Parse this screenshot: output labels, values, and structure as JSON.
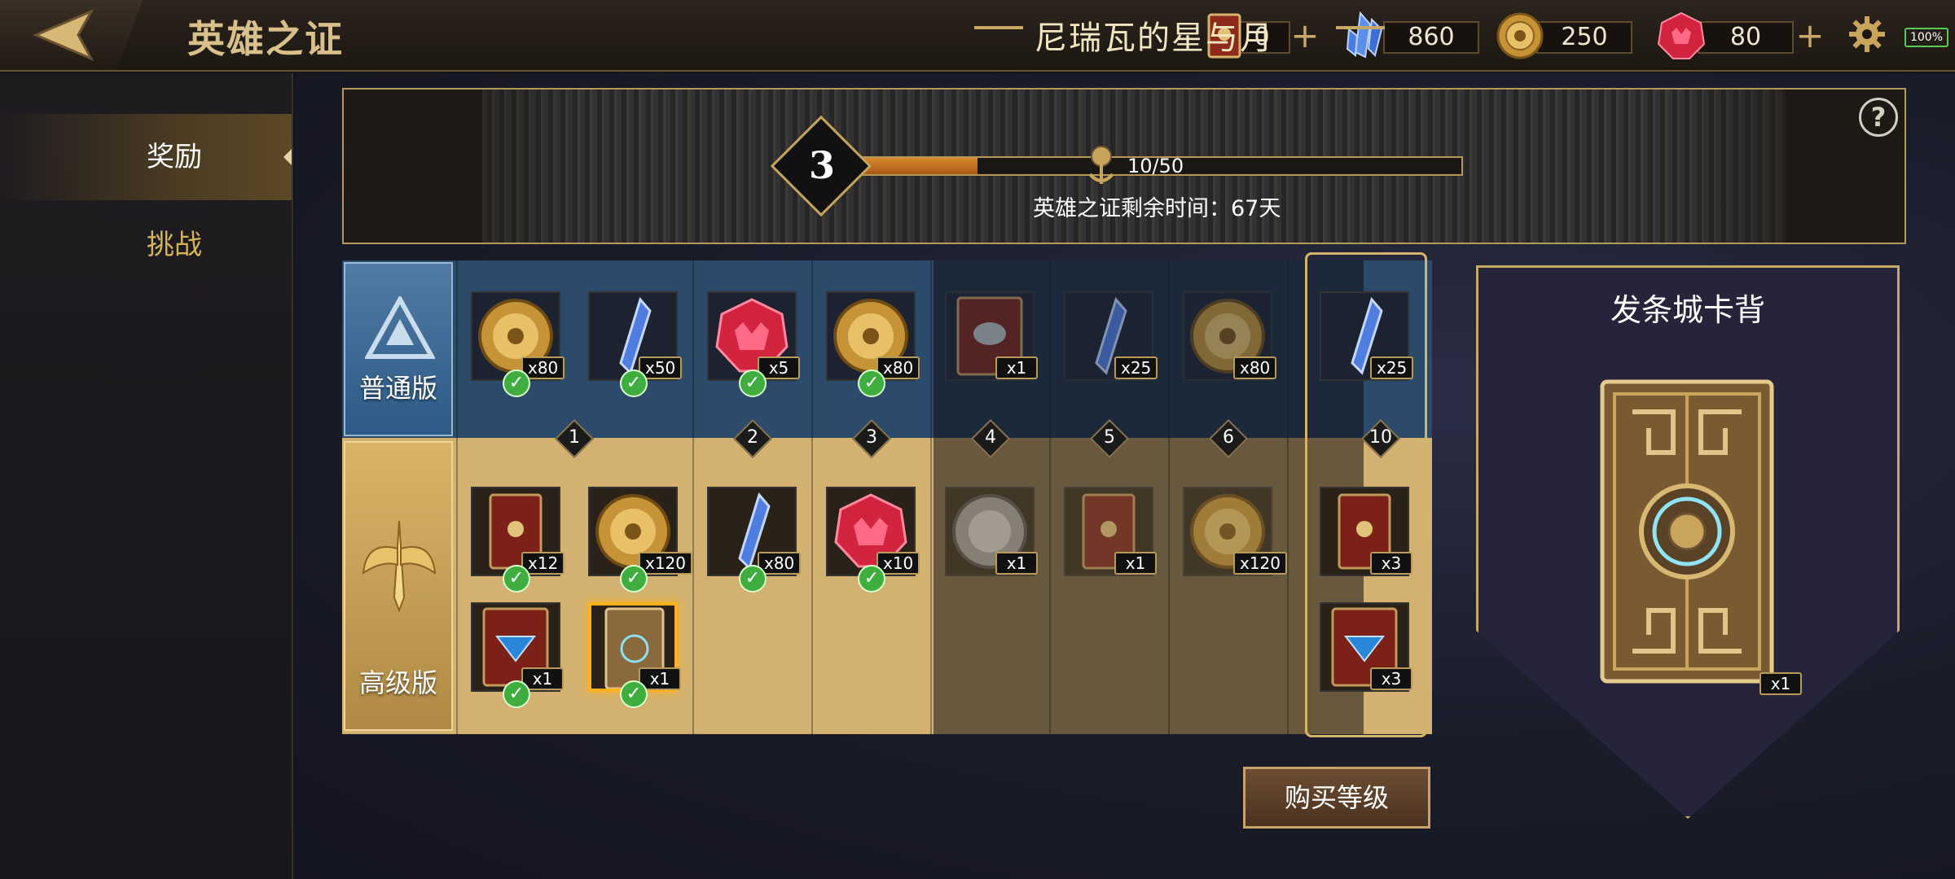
{
  "header": {
    "title": "英雄之证",
    "resources": [
      {
        "icon": "card-pack-icon",
        "value": "0",
        "has_plus": true
      },
      {
        "icon": "blue-crystal-icon",
        "value": "860",
        "has_plus": false
      },
      {
        "icon": "gold-coin-icon",
        "value": "250",
        "has_plus": false
      },
      {
        "icon": "red-gem-icon",
        "value": "80",
        "has_plus": true
      }
    ],
    "battery": "100%"
  },
  "nav": {
    "items": [
      {
        "label": "奖励",
        "active": true
      },
      {
        "label": "挑战",
        "active": false
      }
    ]
  },
  "season": {
    "name": "尼瑞瓦的星与月",
    "level": "3",
    "progress_text": "10/50",
    "progress_fraction": 0.2,
    "remaining": "英雄之证剩余时间：67天",
    "help": "?"
  },
  "track": {
    "free_label": "普通版",
    "premium_label": "高级版",
    "levels": [
      "1",
      "2",
      "3",
      "4",
      "5",
      "6",
      "10"
    ],
    "free_rewards": [
      {
        "icon": "gold-coin-icon",
        "qty": "x80",
        "claimed": true
      },
      {
        "icon": "blue-crystal-icon",
        "qty": "x50",
        "claimed": true
      },
      {
        "icon": "red-gem-icon",
        "qty": "x5",
        "claimed": true
      },
      {
        "icon": "gold-coin-icon",
        "qty": "x80",
        "claimed": true
      },
      {
        "icon": "card-frame-icon",
        "qty": "x1",
        "claimed": false
      },
      {
        "icon": "blue-crystal-icon",
        "qty": "x25",
        "claimed": false
      },
      {
        "icon": "gold-coin-icon",
        "qty": "x80",
        "claimed": false
      },
      {
        "icon": "blue-crystal-icon",
        "qty": "x25",
        "claimed": false
      }
    ],
    "premium_rewards": [
      {
        "icon": "card-pack-icon",
        "qty": "x12",
        "claimed": true
      },
      {
        "icon": "gold-coin-icon",
        "qty": "x120",
        "claimed": true
      },
      {
        "icon": "card-frame-icon",
        "qty": "x1",
        "claimed": true
      },
      {
        "icon": "card-back-icon",
        "qty": "x1",
        "claimed": true,
        "selected": true
      },
      {
        "icon": "blue-crystal-icon",
        "qty": "x80",
        "claimed": true
      },
      {
        "icon": "red-gem-icon",
        "qty": "x10",
        "claimed": true
      },
      {
        "icon": "silver-coin-icon",
        "qty": "x1",
        "claimed": false
      },
      {
        "icon": "card-pack-icon",
        "qty": "x1",
        "claimed": false
      },
      {
        "icon": "gold-coin-icon",
        "qty": "x120",
        "claimed": false
      },
      {
        "icon": "card-pack-icon",
        "qty": "x3",
        "claimed": false
      },
      {
        "icon": "card-frame-icon",
        "qty": "x3",
        "claimed": false
      }
    ]
  },
  "preview": {
    "title": "发条城卡背",
    "qty": "x1"
  },
  "buy_button": "购买等级",
  "colors": {
    "gold": "#c9a45b",
    "free_row": "#2c4a6a",
    "premium_row": "#d3b271",
    "check_green": "#3fae3f",
    "selected": "#ffb21e"
  }
}
